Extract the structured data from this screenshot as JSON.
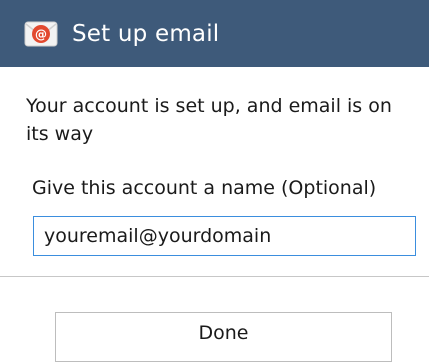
{
  "header": {
    "title": "Set up email",
    "icon": "email-app-icon",
    "background_color": "#3e5a7a"
  },
  "main": {
    "message": "Your account is set up, and email is on its way",
    "name_label": "Give this account a name (Optional)",
    "name_value": "youremail@yourdomain"
  },
  "footer": {
    "done_label": "Done"
  }
}
